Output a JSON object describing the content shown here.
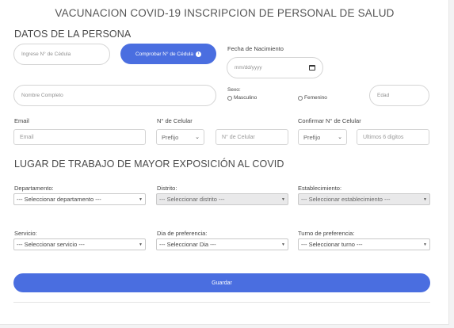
{
  "page": {
    "title": "VACUNACION COVID-19 INSCRIPCION DE PERSONAL DE SALUD"
  },
  "personal": {
    "section_title": "DATOS DE LA PERSONA",
    "cedula_placeholder": "Ingrese N° de Cédula",
    "check_button": "Comprobar N° de Cédula",
    "dob_label": "Fecha de Nacimiento",
    "dob_placeholder": "mm/dd/yyyy",
    "name_placeholder": "Nombre Completo",
    "sex_label": "Sexo:",
    "sex_options": [
      "Masculino",
      "Femenino"
    ],
    "age_placeholder": "Edad",
    "email_label": "Email",
    "email_placeholder": "Email",
    "phone_label": "N° de Celular",
    "prefix_value": "Prefijo",
    "phone_placeholder": "N° de Celular",
    "confirm_label": "Confirmar N° de Celular",
    "confirm_prefix_value": "Prefijo",
    "confirm_placeholder": "Ultimos 6 digitos"
  },
  "work": {
    "section_title": "LUGAR DE TRABAJO DE MAYOR EXPOSICIÓN AL COVID",
    "department_label": "Departamento:",
    "department_value": "--- Seleccionar departamento ---",
    "district_label": "Distrito:",
    "district_value": "--- Seleccionar distrito ---",
    "facility_label": "Establecimiento:",
    "facility_value": "--- Seleccionar establecimiento ---",
    "service_label": "Servicio:",
    "service_value": "--- Seleccionar servicio ---",
    "day_label": "Dia de preferencia:",
    "day_value": "--- Seleccionar Dia ---",
    "shift_label": "Turno de preferencia:",
    "shift_value": "--- Seleccionar turno ---"
  },
  "actions": {
    "save_label": "Guardar"
  },
  "colors": {
    "accent": "#4a6ee0",
    "disabled_field": "#e9e9ea"
  },
  "icons": {
    "check_button_icon": "arrow-circle-right-icon",
    "date_icon": "calendar-icon",
    "select_icon": "chevron-down-icon"
  }
}
